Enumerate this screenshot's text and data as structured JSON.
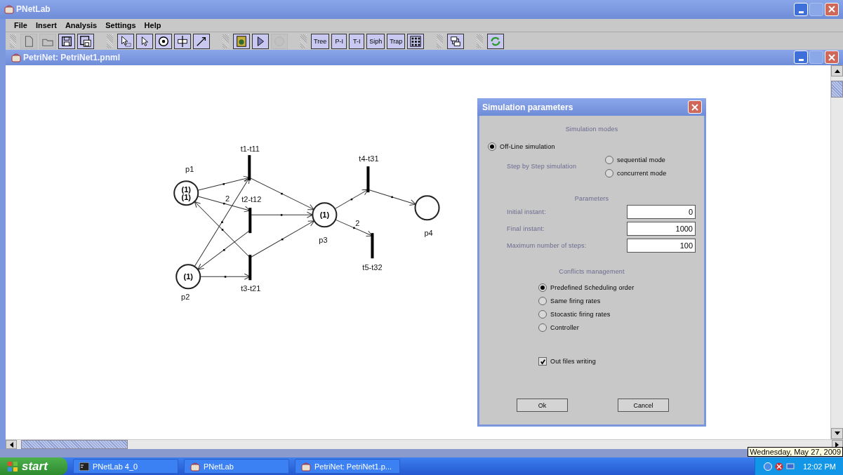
{
  "window": {
    "title": "PNetLab"
  },
  "menu": [
    "File",
    "Insert",
    "Analysis",
    "Settings",
    "Help"
  ],
  "toolbar": [
    {
      "items": [
        {
          "kind": "icon",
          "disabled": true
        },
        {
          "kind": "icon",
          "disabled": true
        },
        {
          "kind": "icon",
          "disabled": false
        },
        {
          "kind": "icon",
          "disabled": false
        }
      ]
    },
    {
      "items": [
        {
          "kind": "icon",
          "disabled": false
        },
        {
          "kind": "icon",
          "disabled": false
        },
        {
          "kind": "icon",
          "disabled": false
        },
        {
          "kind": "icon",
          "disabled": false
        },
        {
          "kind": "icon",
          "disabled": false
        }
      ]
    },
    {
      "items": [
        {
          "kind": "icon",
          "disabled": false
        },
        {
          "kind": "icon",
          "disabled": false
        },
        {
          "kind": "icon",
          "disabled": true
        }
      ]
    },
    {
      "items": [
        {
          "kind": "text",
          "label": "Tree",
          "disabled": false
        },
        {
          "kind": "text",
          "label": "P-I",
          "disabled": false
        },
        {
          "kind": "text",
          "label": "T-I",
          "disabled": false
        },
        {
          "kind": "text",
          "label": "Siph",
          "disabled": false
        },
        {
          "kind": "text",
          "label": "Trap",
          "disabled": false
        },
        {
          "kind": "icon",
          "disabled": false
        }
      ]
    },
    {
      "items": [
        {
          "kind": "icon",
          "disabled": false
        }
      ]
    },
    {
      "items": [
        {
          "kind": "icon",
          "disabled": false
        }
      ]
    }
  ],
  "document": {
    "title": "PetriNet: PetriNet1.pnml"
  },
  "net": {
    "places": [
      {
        "label": "p1",
        "tokens": [
          "(1)",
          "(1)"
        ]
      },
      {
        "label": "p2",
        "tokens": [
          "(1)"
        ]
      },
      {
        "label": "p3",
        "tokens": [
          "(1)"
        ]
      },
      {
        "label": "p4"
      }
    ],
    "transitions": [
      "t1-t11",
      "t2-t12",
      "t3-t21",
      "t4-t31",
      "t5-t32"
    ],
    "arc_weights": [
      "2",
      "2"
    ]
  },
  "dialog": {
    "title": "Simulation parameters",
    "modes_heading": "Simulation modes",
    "offline": {
      "label": "Off-Line simulation",
      "selected": true
    },
    "step_label": "Step by Step simulation",
    "step_modes": [
      {
        "label": "sequential mode",
        "selected": false
      },
      {
        "label": "concurrent mode",
        "selected": false
      }
    ],
    "parameters_heading": "Parameters",
    "parameters": [
      {
        "label": "Initial instant:",
        "value": "0"
      },
      {
        "label": "Final instant:",
        "value": "1000"
      },
      {
        "label": "Maximum number of steps:",
        "value": "100"
      }
    ],
    "conflicts_heading": "Conflicts management",
    "conflicts": [
      {
        "label": "Predefined Scheduling order",
        "selected": true
      },
      {
        "label": "Same firing rates",
        "selected": false
      },
      {
        "label": "Stocastic firing rates",
        "selected": false
      },
      {
        "label": "Controller",
        "selected": false
      }
    ],
    "out_files": {
      "label": "Out files writing",
      "checked": true
    },
    "buttons": [
      "Ok",
      "Cancel"
    ]
  },
  "taskbar": {
    "start": "start",
    "tasks": [
      {
        "label": "PNetLab 4_0",
        "kind": "console"
      },
      {
        "label": "PNetLab",
        "kind": "app"
      },
      {
        "label": "PetriNet: PetriNet1.p...",
        "kind": "app"
      }
    ],
    "clock": "12:02 PM",
    "tooltip": "Wednesday, May 27, 2009"
  }
}
